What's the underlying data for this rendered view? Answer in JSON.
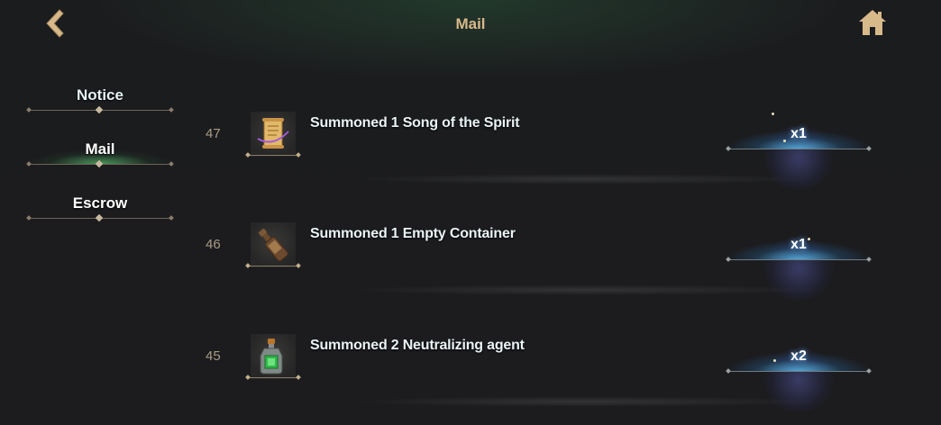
{
  "header": {
    "title": "Mail",
    "back_icon": "chevron-left-icon",
    "home_icon": "home-icon",
    "accent_color": "#d8b98a"
  },
  "tabs": [
    {
      "label": "Notice",
      "active": false
    },
    {
      "label": "Mail",
      "active": true
    },
    {
      "label": "Escrow",
      "active": false
    }
  ],
  "mail": [
    {
      "number": "47",
      "description": "Summoned 1 Song of the Spirit",
      "quantity": "x1",
      "item_icon": "scroll-icon"
    },
    {
      "number": "46",
      "description": "Summoned 1 Empty Container",
      "quantity": "x1",
      "item_icon": "bottle-icon"
    },
    {
      "number": "45",
      "description": "Summoned 2 Neutralizing agent",
      "quantity": "x2",
      "item_icon": "potion-icon"
    }
  ]
}
